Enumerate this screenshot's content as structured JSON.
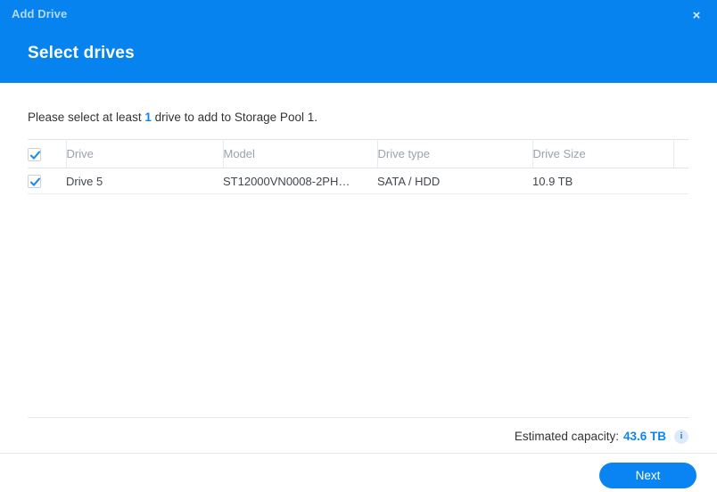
{
  "window": {
    "title": "Add Drive",
    "close_label": "×"
  },
  "header": {
    "heading": "Select drives",
    "background_color": "#0683ef"
  },
  "content": {
    "instruction_prefix": "Please select at least ",
    "instruction_highlight": "1",
    "instruction_suffix": " drive to add to Storage Pool 1."
  },
  "table": {
    "select_all_checked": true,
    "columns": [
      {
        "key": "checkbox",
        "label": ""
      },
      {
        "key": "drive",
        "label": "Drive"
      },
      {
        "key": "model",
        "label": "Model"
      },
      {
        "key": "type",
        "label": "Drive type"
      },
      {
        "key": "size",
        "label": "Drive Size"
      },
      {
        "key": "extra",
        "label": ""
      }
    ],
    "rows": [
      {
        "checked": true,
        "drive": "Drive 5",
        "model": "ST12000VN0008-2PH…",
        "type": "SATA / HDD",
        "size": "10.9 TB"
      }
    ]
  },
  "footer": {
    "capacity_label": "Estimated capacity:",
    "capacity_value": "43.6 TB",
    "info_glyph": "i",
    "accent_color": "#0b84f3"
  },
  "actions": {
    "next_label": "Next"
  }
}
